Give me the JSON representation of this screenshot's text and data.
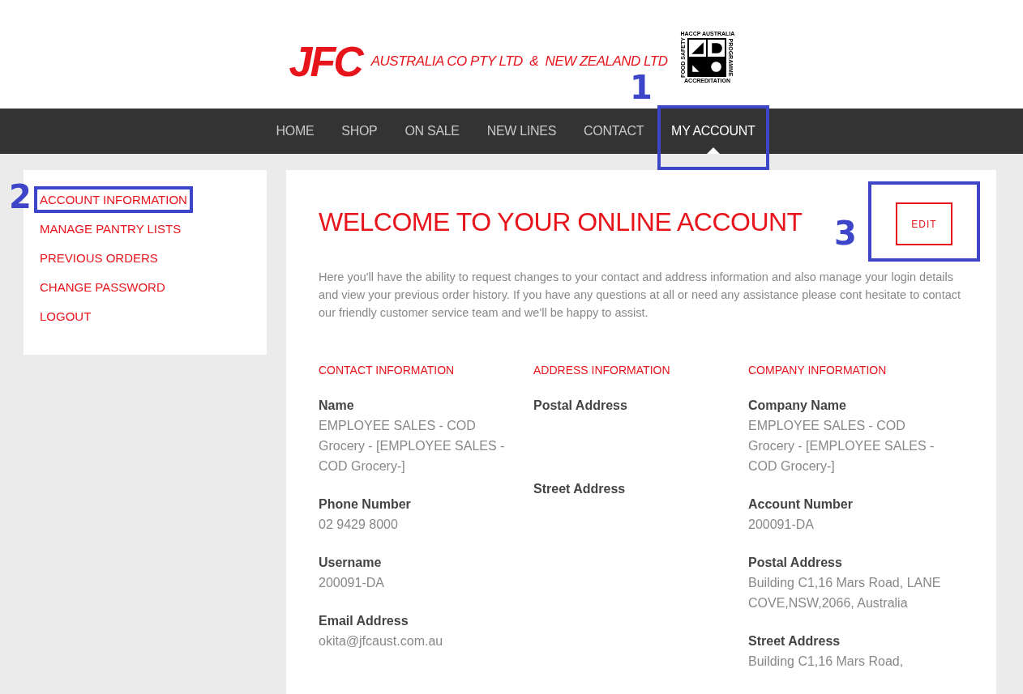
{
  "header": {
    "logo_mark": "JFC",
    "company": "AUSTRALIA CO PTY LTD  &  NEW ZEALAND LTD",
    "badge": {
      "top": "HACCP AUSTRALIA",
      "left": "FOOD SAFETY",
      "right": "PROGRAMME",
      "bottom": "ACCREDITATION"
    }
  },
  "nav": [
    {
      "label": "HOME",
      "selected": false
    },
    {
      "label": "SHOP",
      "selected": false
    },
    {
      "label": "ON SALE",
      "selected": false
    },
    {
      "label": "NEW LINES",
      "selected": false
    },
    {
      "label": "CONTACT",
      "selected": false
    },
    {
      "label": "MY ACCOUNT",
      "selected": true
    }
  ],
  "sidebar": [
    "ACCOUNT INFORMATION",
    "MANAGE PANTRY LISTS",
    "PREVIOUS ORDERS",
    "CHANGE PASSWORD",
    "LOGOUT"
  ],
  "main": {
    "title": "WELCOME TO YOUR ONLINE ACCOUNT",
    "edit_button": "EDIT",
    "intro": "Here you'll have the ability to request changes to your contact and address information and also manage your login details and view your previous order history. If you have any questions at all or need any assistance please cont hesitate to contact our friendly customer service team and we'll be happy to assist.",
    "columns": [
      {
        "heading": "CONTACT INFORMATION",
        "fields": [
          {
            "label": "Name",
            "value": "EMPLOYEE SALES - COD Grocery - [EMPLOYEE SALES -COD Grocery-]"
          },
          {
            "label": "Phone Number",
            "value": "02 9429 8000"
          },
          {
            "label": "Username",
            "value": "200091-DA"
          },
          {
            "label": "Email Address",
            "value": "okita@jfcaust.com.au"
          }
        ]
      },
      {
        "heading": "ADDRESS INFORMATION",
        "fields": [
          {
            "label": "Postal Address"
          },
          {
            "label": "Street Address"
          }
        ]
      },
      {
        "heading": "COMPANY INFORMATION",
        "fields": [
          {
            "label": "Company Name",
            "value": "EMPLOYEE SALES - COD Grocery - [EMPLOYEE SALES -COD Grocery-]"
          },
          {
            "label": "Account Number",
            "value": "200091-DA"
          },
          {
            "label": "Postal Address",
            "value": "Building C1,16 Mars Road, LANE COVE,NSW,2066, Australia"
          },
          {
            "label": "Street Address",
            "value": "Building C1,16 Mars Road,"
          }
        ]
      }
    ]
  },
  "annotations": [
    "1",
    "2",
    "3"
  ]
}
